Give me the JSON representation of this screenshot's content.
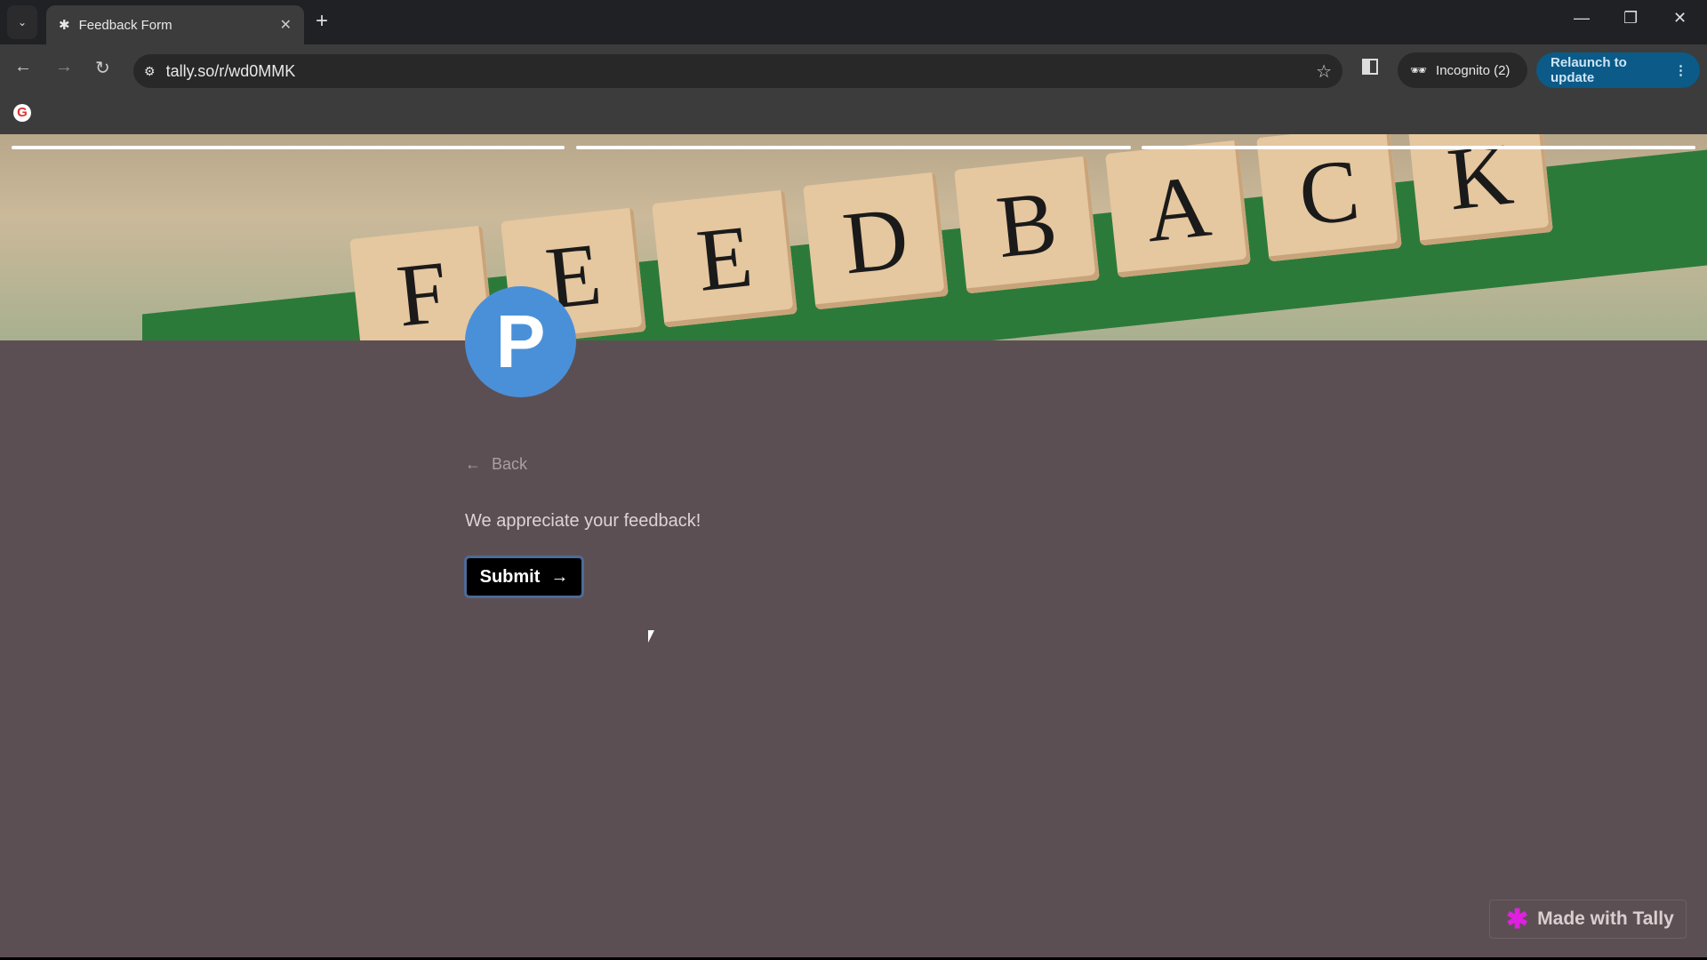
{
  "browser": {
    "tab_title": "Feedback Form",
    "url": "tally.so/r/wd0MMK",
    "incognito_label": "Incognito (2)",
    "relaunch_label": "Relaunch to update"
  },
  "banner": {
    "letters": [
      "F",
      "E",
      "E",
      "D",
      "B",
      "A",
      "C",
      "K"
    ]
  },
  "form": {
    "logo_letter": "P",
    "back_label": "Back",
    "message": "We appreciate your feedback!",
    "submit_label": "Submit",
    "progress_steps": 3,
    "progress_completed": 3
  },
  "footer": {
    "made_with": "Made with Tally"
  },
  "colors": {
    "background": "#5c4f53",
    "logo": "#4a90d9",
    "button": "#000000",
    "tally_accent": "#e020e0",
    "relaunch": "#0b5a87"
  }
}
